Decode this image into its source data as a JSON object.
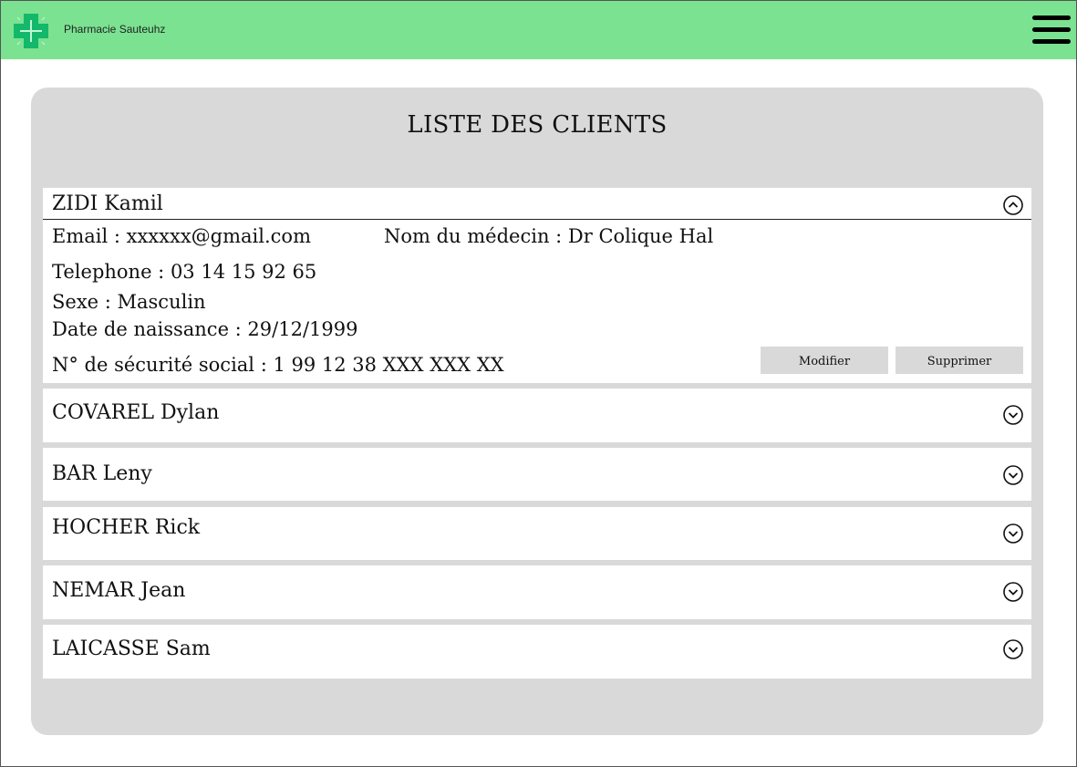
{
  "header": {
    "brand": "Pharmacie Sauteuhz",
    "accent_color": "#7be291",
    "logo_icon": "green-cross-icon",
    "menu_icon": "hamburger-menu-icon"
  },
  "page": {
    "title": "LISTE DES CLIENTS"
  },
  "expanded_client": {
    "name": "ZIDI Kamil",
    "email": "Email : xxxxxx@gmail.com",
    "doctor": "Nom du médecin : Dr Colique Hal",
    "phone": "Telephone : 03 14 15 92 65",
    "sex": "Sexe : Masculin",
    "birth": "Date de naissance : 29/12/1999",
    "ssn": "N° de sécurité social : 1 99 12 38 XXX XXX XX",
    "modify_label": "Modifier",
    "delete_label": "Supprimer"
  },
  "clients": [
    {
      "name": "COVAREL Dylan"
    },
    {
      "name": "BAR Leny"
    },
    {
      "name": "HOCHER Rick"
    },
    {
      "name": "NEMAR Jean"
    },
    {
      "name": "LAICASSE Sam"
    }
  ]
}
